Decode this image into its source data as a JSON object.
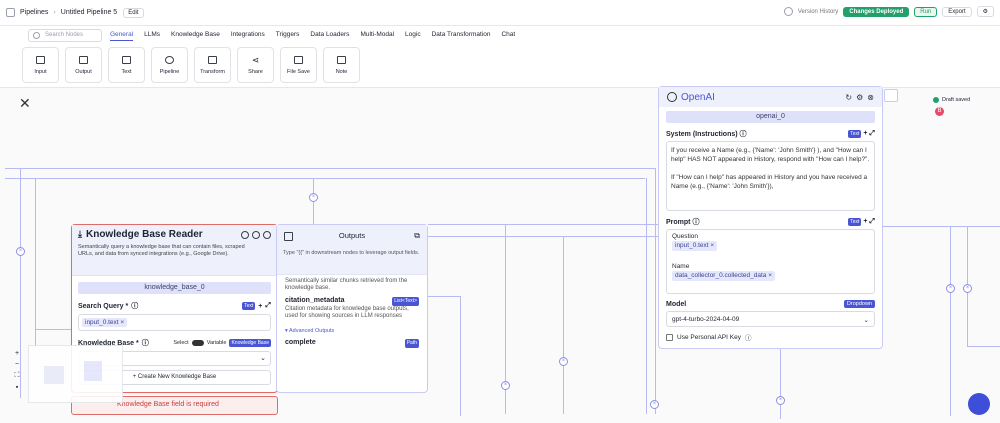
{
  "header": {
    "breadcrumb_root": "Pipelines",
    "breadcrumb_current": "Untitled Pipeline 5",
    "edit_label": "Edit",
    "version_history": "Version History",
    "deploy_label": "Changes Deployed",
    "run_label": "Run",
    "export_label": "Export"
  },
  "toolbar": {
    "search_placeholder": "Search Nodes",
    "tabs": [
      "General",
      "LLMs",
      "Knowledge Base",
      "Integrations",
      "Triggers",
      "Data Loaders",
      "Multi-Modal",
      "Logic",
      "Data Transformation",
      "Chat"
    ],
    "tools": [
      "Input",
      "Output",
      "Text",
      "Pipeline",
      "Transform",
      "Share",
      "File Save",
      "Note"
    ]
  },
  "kb": {
    "title": "Knowledge Base Reader",
    "desc": "Semantically query a knowledge base that can contain files, scraped URLs, and data from synced integrations (e.g., Google Drive).",
    "id": "knowledge_base_0",
    "search_label": "Search Query *",
    "text_tag": "Text",
    "query_value": "input_0.text",
    "kb_label": "Knowledge Base *",
    "select_opt": "Select",
    "variable_opt": "Variable",
    "kb_tag": "Knowledge Base",
    "create_label": "Create New Knowledge Base",
    "error": "Knowledge Base field is required"
  },
  "outputs": {
    "title": "Outputs",
    "desc": "Type \"{{\" in downstream nodes to leverage output fields.",
    "chunks_tail": "Semantically similar chunks retrieved from the knowledge base.",
    "citation_name": "citation_metadata",
    "citation_tag": "List<Text>",
    "citation_desc": "Citation metadata for knowledge base outputs, used for showing sources in LLM responses",
    "advanced": "Advanced Outputs",
    "complete": "complete",
    "path_tag": "Path"
  },
  "openai": {
    "title": "OpenAI",
    "id": "openai_0",
    "system_label": "System (Instructions)",
    "text_tag": "Text",
    "system_text_1": "If you receive a Name (e.g., {'Name': 'John Smith'} ), and \"How can I help\" HAS NOT appeared in History, respond with \"How can I help?\".",
    "system_text_2": "If \"How can I help\" has appeared in History and you have received a Name (e.g., {'Name': 'John Smith'}),",
    "prompt_label": "Prompt",
    "question_label": "Question",
    "question_value": "input_0.text",
    "name_label": "Name",
    "name_value": "data_collector_0.collected_data",
    "model_label": "Model",
    "dropdown_tag": "Dropdown",
    "model_value": "gpt-4-turbo-2024-04-09",
    "personal_key": "Use Personal API Key"
  },
  "status": {
    "draft": "Draft saved",
    "badge": "B"
  },
  "zoom": {
    "plus": "+",
    "minus": "−"
  }
}
